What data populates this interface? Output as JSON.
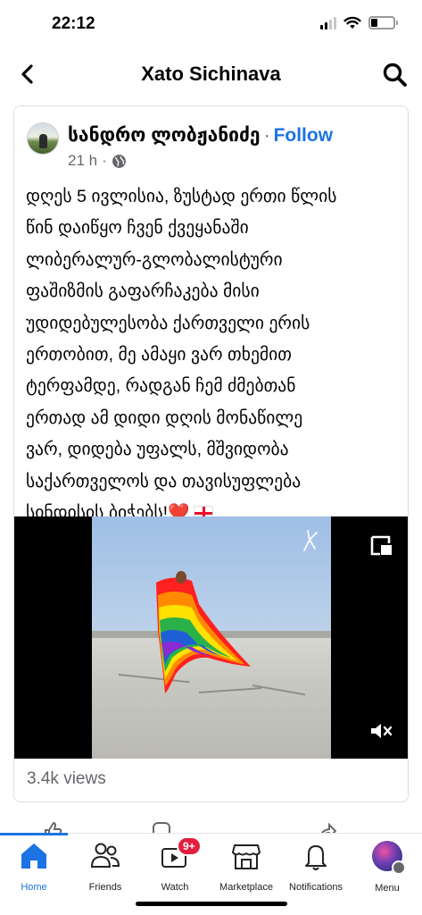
{
  "status_bar": {
    "time": "22:12",
    "battery_level": 0.25
  },
  "nav": {
    "title": "Xato Sichinava"
  },
  "post": {
    "author": "სანდრო ლობჟანიძე",
    "separator": "·",
    "follow_label": "Follow",
    "time": "21 h",
    "time_sep": "·",
    "text_lines": [
      "დღეს 5 ივლისია, ზუსტად ერთი წლის",
      "წინ დაიწყო ჩვენ ქვეყანაში",
      "ლიბერალურ-გლობალისტური",
      "ფაშიზმის გაფარჩაკება მისი",
      "უდიდებულესობა ქართველი ერის",
      "ერთობით, მე ამაყი ვარ თხემით",
      "ტერფამდე, რადგან ჩემ ძმებთან",
      "ერთად ამ დიდი დღის მონაწილე",
      "ვარ, დიდება უფალს, მშვიდობა",
      "საქართველოს და თავისუფლება"
    ],
    "last_line": "სინდისის ბიჭებს!",
    "emoji_heart": "❤️",
    "views": "3.4k views"
  },
  "tabbar": {
    "tabs": [
      {
        "label": "Home",
        "icon": "home-icon",
        "active": true
      },
      {
        "label": "Friends",
        "icon": "friends-icon"
      },
      {
        "label": "Watch",
        "icon": "watch-icon",
        "badge": "9+"
      },
      {
        "label": "Marketplace",
        "icon": "marketplace-icon"
      },
      {
        "label": "Notifications",
        "icon": "bell-icon"
      },
      {
        "label": "Menu",
        "icon": "menu-avatar"
      }
    ]
  },
  "colors": {
    "accent": "#1b74e4",
    "badge": "#e41e3f",
    "secondary_text": "#65676b"
  }
}
